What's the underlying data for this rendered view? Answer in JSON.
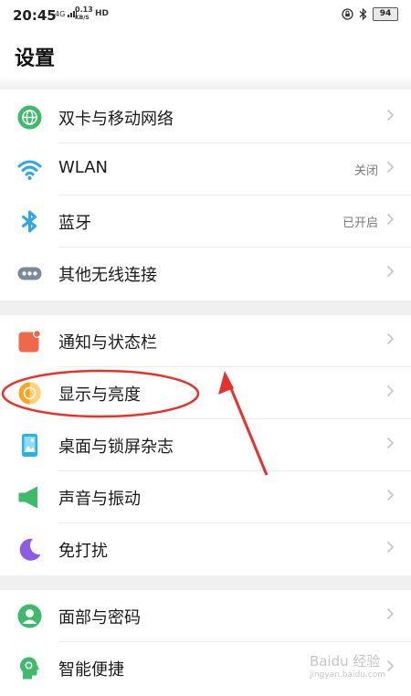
{
  "status_bar": {
    "time": "20:45",
    "network": "4G",
    "speed_value": "0.13",
    "speed_unit": "KB/S",
    "hd": "HD",
    "battery": "94"
  },
  "header": {
    "title": "设置"
  },
  "groups": [
    {
      "items": [
        {
          "label": "双卡与移动网络",
          "value": "",
          "icon": "globe-icon",
          "color": "#3dbb6b"
        },
        {
          "label": "WLAN",
          "value": "关闭",
          "icon": "wifi-icon",
          "color": "#2ea7e8"
        },
        {
          "label": "蓝牙",
          "value": "已开启",
          "icon": "bluetooth-icon",
          "color": "#2ea7e8"
        },
        {
          "label": "其他无线连接",
          "value": "",
          "icon": "more-connections-icon",
          "color": "#7b8a99"
        }
      ]
    },
    {
      "items": [
        {
          "label": "通知与状态栏",
          "value": "",
          "icon": "notification-icon",
          "color": "#f0684a"
        },
        {
          "label": "显示与亮度",
          "value": "",
          "icon": "brightness-icon",
          "color": "#f5a623"
        },
        {
          "label": "桌面与锁屏杂志",
          "value": "",
          "icon": "wallpaper-icon",
          "color": "#25b3e8"
        },
        {
          "label": "声音与振动",
          "value": "",
          "icon": "speaker-icon",
          "color": "#3dbb6b"
        },
        {
          "label": "免打扰",
          "value": "",
          "icon": "moon-icon",
          "color": "#8e5ce3"
        }
      ]
    },
    {
      "items": [
        {
          "label": "面部与密码",
          "value": "",
          "icon": "face-password-icon",
          "color": "#3dbb6b"
        },
        {
          "label": "智能便捷",
          "value": "",
          "icon": "smart-assist-icon",
          "color": "#3dbb6b"
        }
      ]
    }
  ],
  "annotation_color": "#e8312c",
  "watermark": {
    "main": "Baidu 经验",
    "sub": "jingyan.baidu.com"
  }
}
